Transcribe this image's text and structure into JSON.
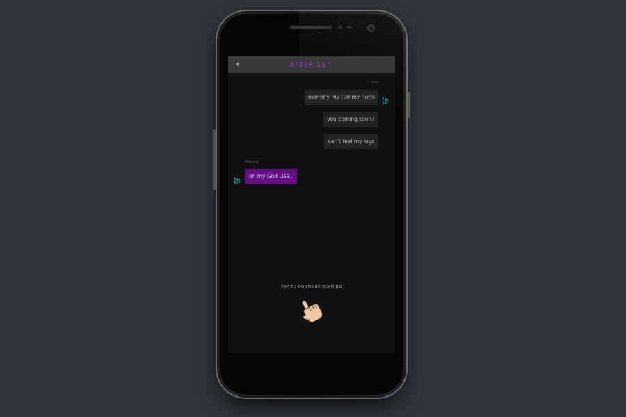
{
  "header": {
    "title": "AFTER 11™",
    "back_icon": "chevron-left-icon"
  },
  "chat": {
    "messages": [
      {
        "sender": "Lisa",
        "text": "mommy my tummy hurts"
      },
      {
        "sender": "",
        "text": "you coming soon?"
      },
      {
        "sender": "",
        "text": "can't feel my legs"
      },
      {
        "sender": "Mommy",
        "text": "oh my God Lisa.."
      }
    ]
  },
  "footer": {
    "cta": "TAP TO CONTINUE READING",
    "cta_icon": "pointing-hand-icon"
  },
  "colors": {
    "accent": "#b23ee2",
    "mommy_bubble": "#650f82",
    "lisa_bubble": "#242424",
    "screen_bg": "#111111",
    "header_bg": "#3a3a3a",
    "page_bg": "#2f343b"
  }
}
